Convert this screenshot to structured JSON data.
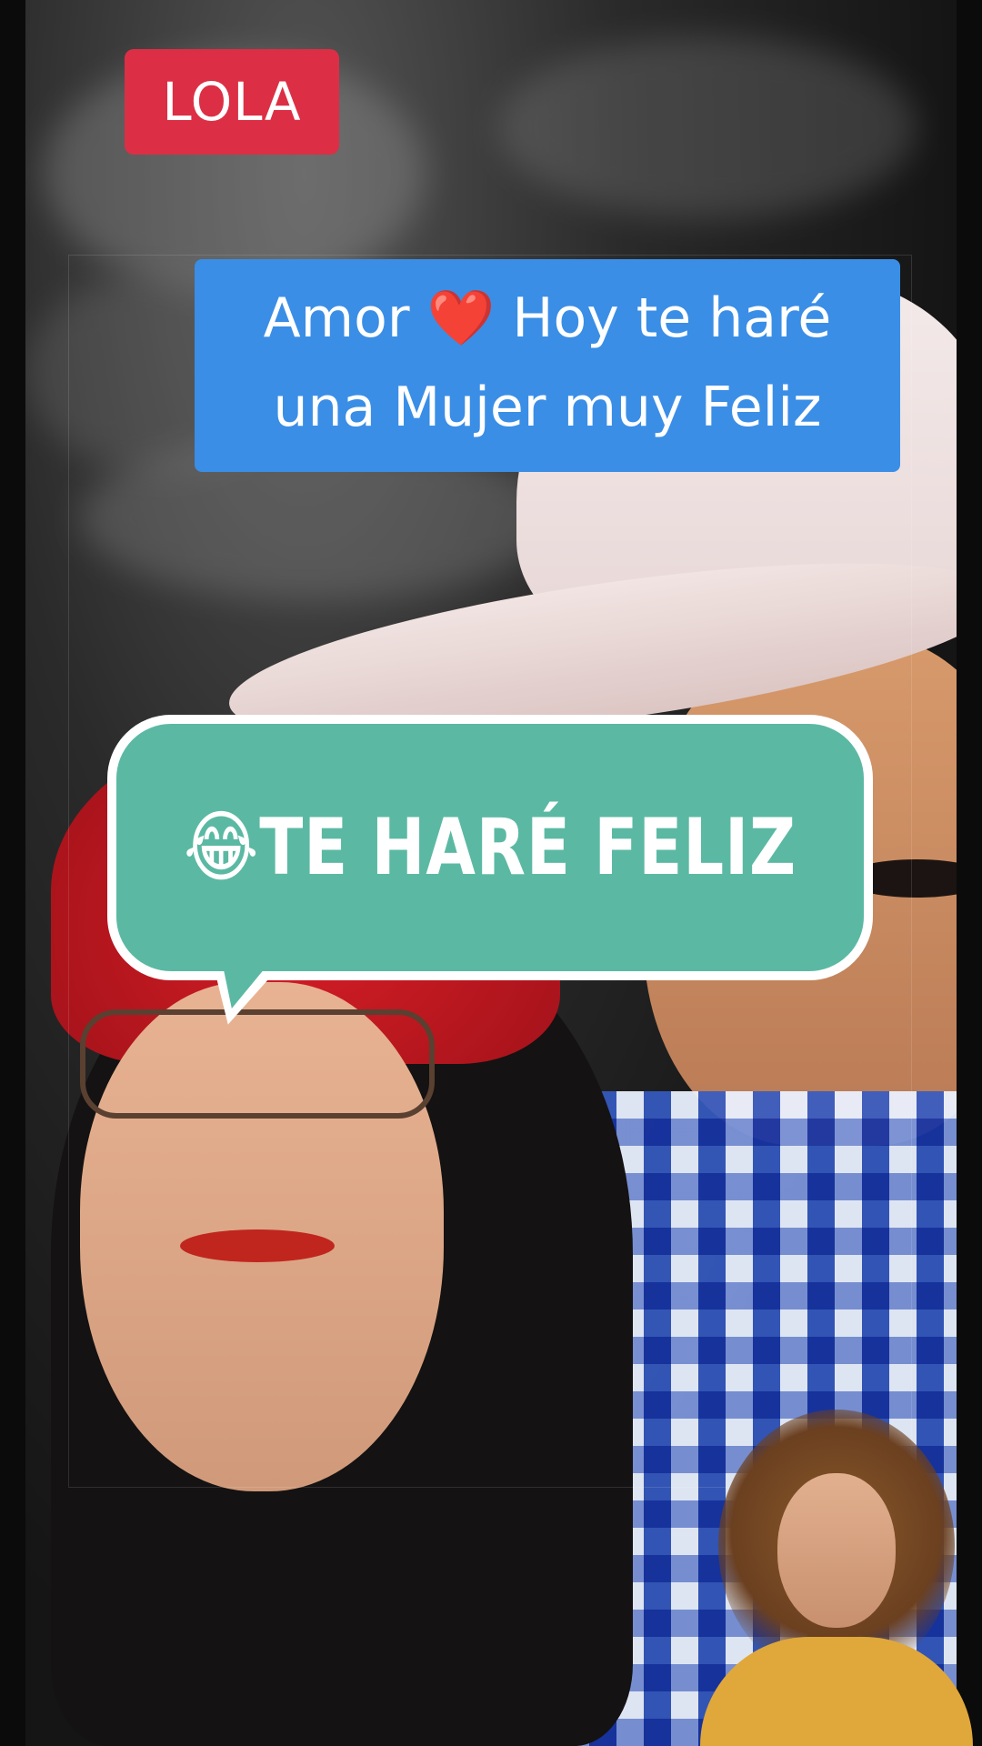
{
  "video": {
    "creator_tag": "LOLA",
    "caption": {
      "line1": "Amor ❤️ Hoy te haré",
      "line2": "una Mujer muy Feliz"
    },
    "speech_bubble": {
      "text": "😂TE HARÉ FELIZ"
    }
  },
  "colors": {
    "tag_background": "#dc2f45",
    "caption_background": "#3a8ee6",
    "bubble_background": "#5bb9a3",
    "bubble_border": "#ffffff"
  }
}
